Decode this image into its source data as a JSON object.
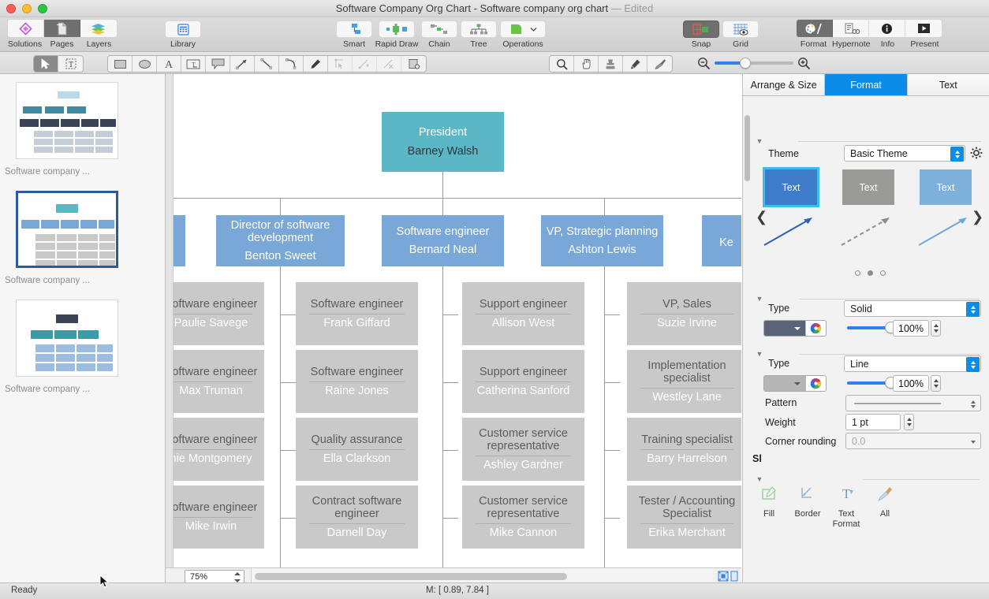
{
  "window": {
    "title": "Software Company Org Chart - Software company org chart",
    "edited_suffix": "— Edited",
    "traffic_lights": [
      "close-button",
      "minimize-button",
      "zoom-button"
    ]
  },
  "toolbar": {
    "left_group": [
      {
        "label": "Solutions",
        "icon": "solutions-icon",
        "active": false
      },
      {
        "label": "Pages",
        "icon": "pages-icon",
        "active": true
      },
      {
        "label": "Layers",
        "icon": "layers-icon",
        "active": false
      }
    ],
    "library": {
      "label": "Library",
      "icon": "library-icon"
    },
    "center_group": [
      {
        "label": "Smart",
        "icon": "smart-connector-icon"
      },
      {
        "label": "Rapid Draw",
        "icon": "rapid-draw-icon"
      },
      {
        "label": "Chain",
        "icon": "chain-icon"
      },
      {
        "label": "Tree",
        "icon": "tree-icon"
      },
      {
        "label": "Operations",
        "icon": "operations-icon"
      }
    ],
    "snap_grid": [
      {
        "label": "Snap",
        "icon": "snap-icon",
        "active": true
      },
      {
        "label": "Grid",
        "icon": "grid-icon",
        "active": false
      }
    ],
    "right_group": [
      {
        "label": "Format",
        "icon": "format-palette-icon",
        "active": true
      },
      {
        "label": "Hypernote",
        "icon": "hypernote-icon",
        "active": false
      },
      {
        "label": "Info",
        "icon": "info-icon",
        "active": false
      },
      {
        "label": "Present",
        "icon": "present-icon",
        "active": false
      }
    ]
  },
  "toolrow": {
    "select_tools": [
      {
        "icon": "pointer-tool-icon",
        "active": true
      },
      {
        "icon": "text-select-tool-icon",
        "active": false
      }
    ],
    "draw_tools": [
      {
        "icon": "rectangle-tool-icon",
        "disabled": false
      },
      {
        "icon": "ellipse-tool-icon",
        "disabled": false
      },
      {
        "icon": "text-tool-icon",
        "disabled": false
      },
      {
        "icon": "text-box-tool-icon",
        "disabled": false
      },
      {
        "icon": "callout-tool-icon",
        "disabled": false
      },
      {
        "icon": "arrow-tool-icon",
        "disabled": false
      },
      {
        "icon": "line-tool-icon",
        "disabled": false
      },
      {
        "icon": "curve-tool-icon",
        "disabled": false
      },
      {
        "icon": "pen-tool-icon",
        "disabled": false
      },
      {
        "icon": "edit-point-tool-icon",
        "disabled": true
      },
      {
        "icon": "add-point-tool-icon",
        "disabled": true
      },
      {
        "icon": "delete-point-tool-icon",
        "disabled": true
      },
      {
        "icon": "shape-action-tool-icon",
        "disabled": false
      }
    ],
    "view_tools": [
      {
        "icon": "magnifier-tool-icon"
      },
      {
        "icon": "hand-tool-icon"
      },
      {
        "icon": "stamp-tool-icon"
      },
      {
        "icon": "eyedropper-tool-icon"
      },
      {
        "icon": "paintbrush-tool-icon"
      }
    ],
    "zoom_out_icon": "zoom-out-icon",
    "zoom_in_icon": "zoom-in-icon"
  },
  "sidebar": {
    "pages": [
      {
        "label": "Software company ...",
        "selected": false
      },
      {
        "label": "Software company ...",
        "selected": true
      },
      {
        "label": "Software company ...",
        "selected": false
      }
    ]
  },
  "canvas": {
    "zoom_level": "75%",
    "nodes": [
      {
        "role": "President",
        "name": "Barney Walsh",
        "style": "teal"
      },
      {
        "role": "Director of software development",
        "name": "Benton Sweet",
        "style": "blue"
      },
      {
        "role": "Software engineer",
        "name": "Bernard Neal",
        "style": "blue"
      },
      {
        "role": "VP, Strategic planning",
        "name": "Ashton Lewis",
        "style": "blue"
      },
      {
        "role": "Software engineer",
        "name": "Paulie Savege",
        "style": "gray"
      },
      {
        "role": "Software engineer",
        "name": "Frank Giffard",
        "style": "gray"
      },
      {
        "role": "Support engineer",
        "name": "Allison West",
        "style": "gray"
      },
      {
        "role": "VP, Sales",
        "name": "Suzie Irvine",
        "style": "gray"
      },
      {
        "role": "Software engineer",
        "name": "Max Truman",
        "style": "gray"
      },
      {
        "role": "Software engineer",
        "name": "Raine Jones",
        "style": "gray"
      },
      {
        "role": "Support engineer",
        "name": "Catherina Sanford",
        "style": "gray"
      },
      {
        "role": "Implementation specialist",
        "name": "Westley Lane",
        "style": "gray"
      },
      {
        "role": "Software engineer",
        "name": "nie Montgomery",
        "style": "gray"
      },
      {
        "role": "Quality assurance",
        "name": "Ella Clarkson",
        "style": "gray"
      },
      {
        "role": "Customer service representative",
        "name": "Ashley Gardner",
        "style": "gray"
      },
      {
        "role": "Training specialist",
        "name": "Barry Harrelson",
        "style": "gray"
      },
      {
        "role": "Software engineer",
        "name": "Mike Irwin",
        "style": "gray"
      },
      {
        "role": "Contract software engineer",
        "name": "Darnell Day",
        "style": "gray"
      },
      {
        "role": "Customer service representative",
        "name": "Mike Cannon",
        "style": "gray"
      },
      {
        "role": "Tester / Accounting Specialist",
        "name": "Erika Merchant",
        "style": "gray"
      }
    ],
    "colors": {
      "teal": "#5bb6c6",
      "blue": "#79a8d8",
      "gray": "#c9c9c9"
    }
  },
  "inspector": {
    "tabs": [
      {
        "label": "Arrange & Size",
        "active": false
      },
      {
        "label": "Format",
        "active": true
      },
      {
        "label": "Text",
        "active": false
      }
    ],
    "theme": {
      "label": "Theme",
      "value": "Basic Theme",
      "gear_icon": "gear-icon",
      "cards": [
        {
          "label": "Text",
          "color": "#3d7cc9",
          "selected": true
        },
        {
          "label": "Text",
          "color": "#9a9a96",
          "selected": false
        },
        {
          "label": "Text",
          "color": "#7eb0dc",
          "selected": false
        }
      ],
      "prev_icon": "chevron-left-icon",
      "next_icon": "chevron-right-icon",
      "page_dots": 3,
      "active_dot": 1
    },
    "fill": {
      "type_label": "Type",
      "type_value": "Solid",
      "color": "#59637a",
      "opacity": "100%",
      "color_wheel_icon": "color-wheel-icon"
    },
    "border": {
      "type_label": "Type",
      "type_value": "Line",
      "color": "#b5b5b5",
      "opacity": "100%",
      "pattern_label": "Pattern",
      "weight_label": "Weight",
      "weight_value": "1 pt",
      "corner_label": "Corner rounding",
      "corner_value": "0.0",
      "color_wheel_icon": "color-wheel-icon"
    },
    "shadow_partial_label": "Sl",
    "format_painter": [
      {
        "label": "Fill",
        "icon": "fill-paint-icon"
      },
      {
        "label": "Border",
        "icon": "border-paint-icon"
      },
      {
        "label": "Text Format",
        "icon": "text-format-paint-icon"
      },
      {
        "label": "All",
        "icon": "all-paint-icon"
      }
    ]
  },
  "statusbar": {
    "ready": "Ready",
    "coordinates": "M: [ 0.89, 7.84 ]"
  }
}
